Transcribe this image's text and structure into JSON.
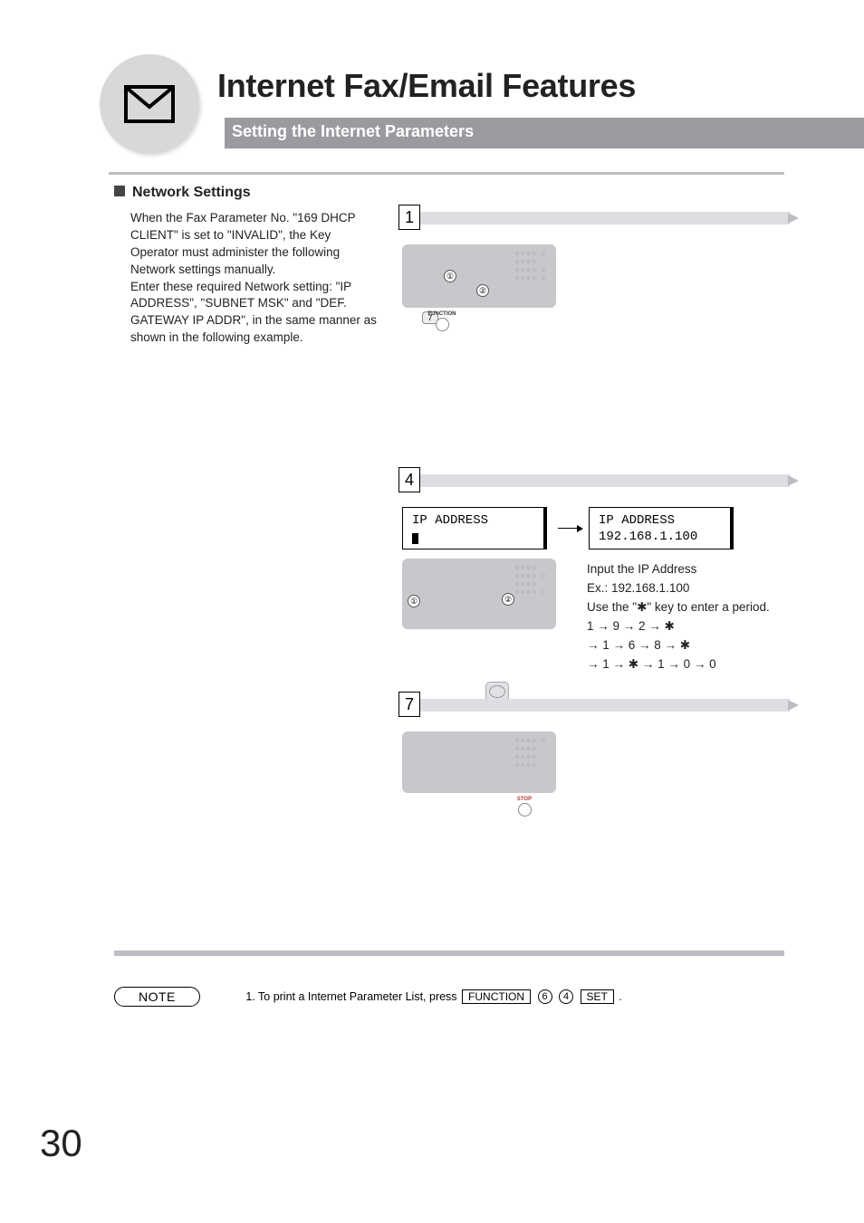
{
  "header": {
    "title": "Internet Fax/Email Features",
    "subtitle": "Setting the Internet Parameters",
    "icon": "envelope-icon"
  },
  "section": {
    "heading": "Network Settings",
    "intro": "When the Fax Parameter No. \"169 DHCP CLIENT\" is set to \"INVALID\", the Key Operator must administer the following Network settings manually.\nEnter these required Network setting: \"IP ADDRESS\", \"SUBNET MSK\" and \"DEF. GATEWAY IP ADDR\", in the same manner as shown in the following example."
  },
  "steps": {
    "s1": {
      "num": "1",
      "func_label": "FUNCTION",
      "keypad_seven": "7"
    },
    "s4": {
      "num": "4",
      "lcd_left_line1": "IP ADDRESS",
      "lcd_right_line1": "IP ADDRESS",
      "lcd_right_line2": "192.168.1.100",
      "instr_l1": "Input the IP Address",
      "instr_l2": "Ex.: 192.168.1.100",
      "instr_l3_pre": "Use the \"",
      "instr_l3_post": "\" key to enter a period.",
      "instr_l4": "1 → 9 → 2 → ✱",
      "instr_l5": "→ 1 → 6 → 8 → ✱",
      "instr_l6": "→ 1 → ✱ → 1 → 0 → 0"
    },
    "s7": {
      "num": "7",
      "stop_label": "STOP"
    }
  },
  "note": {
    "label": "NOTE",
    "text_pre": "1. To print a Internet Parameter List, press",
    "key_function": "FUNCTION",
    "key_6": "6",
    "key_4": "4",
    "key_set": "SET",
    "text_post": "."
  },
  "page_number": "30"
}
